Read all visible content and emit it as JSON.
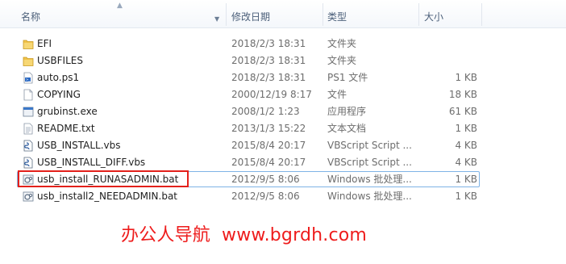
{
  "columns": {
    "name": "名称",
    "date_modified": "修改日期",
    "type": "类型",
    "size": "大小"
  },
  "files": [
    {
      "name": "EFI",
      "date": "2018/2/3 18:31",
      "type": "文件夹",
      "size": "",
      "icon": "folder-icon"
    },
    {
      "name": "USBFILES",
      "date": "2018/2/3 18:31",
      "type": "文件夹",
      "size": "",
      "icon": "folder-icon"
    },
    {
      "name": "auto.ps1",
      "date": "2018/2/3 18:31",
      "type": "PS1 文件",
      "size": "1 KB",
      "icon": "powershell-file-icon"
    },
    {
      "name": "COPYING",
      "date": "2000/12/19 8:17",
      "type": "文件",
      "size": "18 KB",
      "icon": "blank-file-icon"
    },
    {
      "name": "grubinst.exe",
      "date": "2008/1/2 1:23",
      "type": "应用程序",
      "size": "61 KB",
      "icon": "application-icon"
    },
    {
      "name": "README.txt",
      "date": "2013/1/3 15:22",
      "type": "文本文档",
      "size": "1 KB",
      "icon": "text-file-icon"
    },
    {
      "name": "USB_INSTALL.vbs",
      "date": "2015/8/4 20:17",
      "type": "VBScript Script ...",
      "size": "4 KB",
      "icon": "vbscript-file-icon"
    },
    {
      "name": "USB_INSTALL_DIFF.vbs",
      "date": "2015/8/4 20:17",
      "type": "VBScript Script ...",
      "size": "4 KB",
      "icon": "vbscript-file-icon"
    },
    {
      "name": "usb_install_RUNASADMIN.bat",
      "date": "2012/9/5 8:06",
      "type": "Windows 批处理...",
      "size": "1 KB",
      "icon": "batch-file-icon"
    },
    {
      "name": "usb_install2_NEEDADMIN.bat",
      "date": "2012/9/5 8:06",
      "type": "Windows 批处理...",
      "size": "1 KB",
      "icon": "batch-file-icon"
    }
  ],
  "watermark": {
    "cn": "办公人导航",
    "url": "www.bgrdh.com"
  },
  "colors": {
    "folder": "#f0c24a",
    "highlight_box": "#e3201b",
    "selection_outline": "#7fb3e6",
    "watermark": "#ee1c1c"
  }
}
